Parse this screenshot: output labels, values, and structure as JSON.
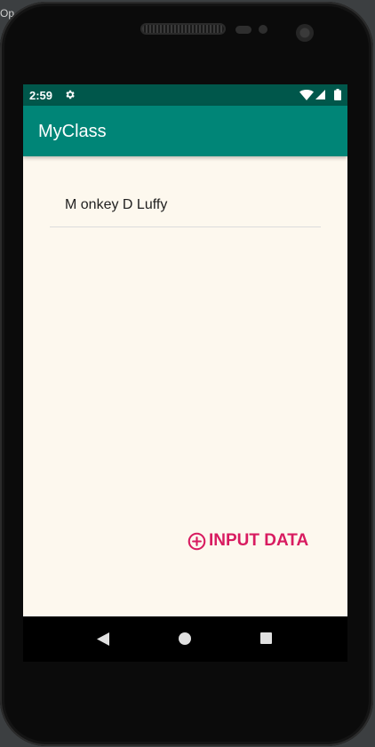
{
  "window": {
    "corner_text": "Op"
  },
  "status_bar": {
    "time": "2:59",
    "icons": [
      "gear-icon",
      "wifi-icon",
      "signal-icon",
      "battery-icon"
    ]
  },
  "app_bar": {
    "title": "MyClass"
  },
  "list": {
    "items": [
      {
        "label": "M onkey D Luffy"
      }
    ]
  },
  "actions": {
    "input_data_label": "INPUT DATA",
    "input_data_icon": "add-circle-icon"
  },
  "nav_bar": {
    "icons": [
      "back-icon",
      "home-icon",
      "recents-icon"
    ]
  },
  "colors": {
    "status_bar": "#00574b",
    "app_bar": "#008577",
    "accent": "#d81b60",
    "background": "#fdf8ee"
  }
}
